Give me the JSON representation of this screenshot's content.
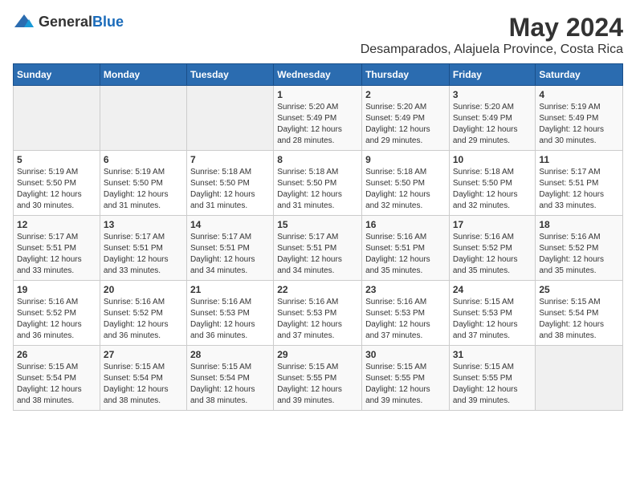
{
  "header": {
    "logo_general": "General",
    "logo_blue": "Blue",
    "title": "May 2024",
    "subtitle": "Desamparados, Alajuela Province, Costa Rica"
  },
  "calendar": {
    "days_of_week": [
      "Sunday",
      "Monday",
      "Tuesday",
      "Wednesday",
      "Thursday",
      "Friday",
      "Saturday"
    ],
    "weeks": [
      [
        {
          "day": "",
          "info": ""
        },
        {
          "day": "",
          "info": ""
        },
        {
          "day": "",
          "info": ""
        },
        {
          "day": "1",
          "info": "Sunrise: 5:20 AM\nSunset: 5:49 PM\nDaylight: 12 hours\nand 28 minutes."
        },
        {
          "day": "2",
          "info": "Sunrise: 5:20 AM\nSunset: 5:49 PM\nDaylight: 12 hours\nand 29 minutes."
        },
        {
          "day": "3",
          "info": "Sunrise: 5:20 AM\nSunset: 5:49 PM\nDaylight: 12 hours\nand 29 minutes."
        },
        {
          "day": "4",
          "info": "Sunrise: 5:19 AM\nSunset: 5:49 PM\nDaylight: 12 hours\nand 30 minutes."
        }
      ],
      [
        {
          "day": "5",
          "info": "Sunrise: 5:19 AM\nSunset: 5:50 PM\nDaylight: 12 hours\nand 30 minutes."
        },
        {
          "day": "6",
          "info": "Sunrise: 5:19 AM\nSunset: 5:50 PM\nDaylight: 12 hours\nand 31 minutes."
        },
        {
          "day": "7",
          "info": "Sunrise: 5:18 AM\nSunset: 5:50 PM\nDaylight: 12 hours\nand 31 minutes."
        },
        {
          "day": "8",
          "info": "Sunrise: 5:18 AM\nSunset: 5:50 PM\nDaylight: 12 hours\nand 31 minutes."
        },
        {
          "day": "9",
          "info": "Sunrise: 5:18 AM\nSunset: 5:50 PM\nDaylight: 12 hours\nand 32 minutes."
        },
        {
          "day": "10",
          "info": "Sunrise: 5:18 AM\nSunset: 5:50 PM\nDaylight: 12 hours\nand 32 minutes."
        },
        {
          "day": "11",
          "info": "Sunrise: 5:17 AM\nSunset: 5:51 PM\nDaylight: 12 hours\nand 33 minutes."
        }
      ],
      [
        {
          "day": "12",
          "info": "Sunrise: 5:17 AM\nSunset: 5:51 PM\nDaylight: 12 hours\nand 33 minutes."
        },
        {
          "day": "13",
          "info": "Sunrise: 5:17 AM\nSunset: 5:51 PM\nDaylight: 12 hours\nand 33 minutes."
        },
        {
          "day": "14",
          "info": "Sunrise: 5:17 AM\nSunset: 5:51 PM\nDaylight: 12 hours\nand 34 minutes."
        },
        {
          "day": "15",
          "info": "Sunrise: 5:17 AM\nSunset: 5:51 PM\nDaylight: 12 hours\nand 34 minutes."
        },
        {
          "day": "16",
          "info": "Sunrise: 5:16 AM\nSunset: 5:51 PM\nDaylight: 12 hours\nand 35 minutes."
        },
        {
          "day": "17",
          "info": "Sunrise: 5:16 AM\nSunset: 5:52 PM\nDaylight: 12 hours\nand 35 minutes."
        },
        {
          "day": "18",
          "info": "Sunrise: 5:16 AM\nSunset: 5:52 PM\nDaylight: 12 hours\nand 35 minutes."
        }
      ],
      [
        {
          "day": "19",
          "info": "Sunrise: 5:16 AM\nSunset: 5:52 PM\nDaylight: 12 hours\nand 36 minutes."
        },
        {
          "day": "20",
          "info": "Sunrise: 5:16 AM\nSunset: 5:52 PM\nDaylight: 12 hours\nand 36 minutes."
        },
        {
          "day": "21",
          "info": "Sunrise: 5:16 AM\nSunset: 5:53 PM\nDaylight: 12 hours\nand 36 minutes."
        },
        {
          "day": "22",
          "info": "Sunrise: 5:16 AM\nSunset: 5:53 PM\nDaylight: 12 hours\nand 37 minutes."
        },
        {
          "day": "23",
          "info": "Sunrise: 5:16 AM\nSunset: 5:53 PM\nDaylight: 12 hours\nand 37 minutes."
        },
        {
          "day": "24",
          "info": "Sunrise: 5:15 AM\nSunset: 5:53 PM\nDaylight: 12 hours\nand 37 minutes."
        },
        {
          "day": "25",
          "info": "Sunrise: 5:15 AM\nSunset: 5:54 PM\nDaylight: 12 hours\nand 38 minutes."
        }
      ],
      [
        {
          "day": "26",
          "info": "Sunrise: 5:15 AM\nSunset: 5:54 PM\nDaylight: 12 hours\nand 38 minutes."
        },
        {
          "day": "27",
          "info": "Sunrise: 5:15 AM\nSunset: 5:54 PM\nDaylight: 12 hours\nand 38 minutes."
        },
        {
          "day": "28",
          "info": "Sunrise: 5:15 AM\nSunset: 5:54 PM\nDaylight: 12 hours\nand 38 minutes."
        },
        {
          "day": "29",
          "info": "Sunrise: 5:15 AM\nSunset: 5:55 PM\nDaylight: 12 hours\nand 39 minutes."
        },
        {
          "day": "30",
          "info": "Sunrise: 5:15 AM\nSunset: 5:55 PM\nDaylight: 12 hours\nand 39 minutes."
        },
        {
          "day": "31",
          "info": "Sunrise: 5:15 AM\nSunset: 5:55 PM\nDaylight: 12 hours\nand 39 minutes."
        },
        {
          "day": "",
          "info": ""
        }
      ]
    ]
  }
}
